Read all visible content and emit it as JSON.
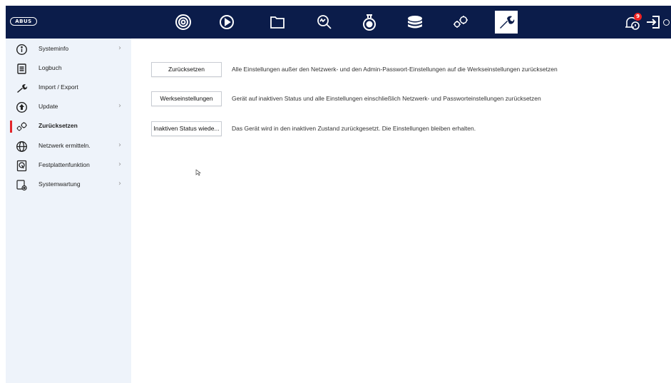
{
  "brand": {
    "logo_text": "ABUS"
  },
  "topbar": {
    "icons": [
      {
        "name": "live-view-icon",
        "label": "camera"
      },
      {
        "name": "playback-icon",
        "label": "play"
      },
      {
        "name": "file-management-icon",
        "label": "folder"
      },
      {
        "name": "smart-analysis-icon",
        "label": "search"
      },
      {
        "name": "camera-settings-icon",
        "label": "dome"
      },
      {
        "name": "storage-icon",
        "label": "storage"
      },
      {
        "name": "configuration-icon",
        "label": "gears"
      },
      {
        "name": "maintenance-icon",
        "label": "wrench",
        "active": true
      }
    ],
    "alarm_count": "9"
  },
  "sidebar": {
    "items": [
      {
        "label": "Systeminfo",
        "icon": "info-icon",
        "has_submenu": true
      },
      {
        "label": "Logbuch",
        "icon": "log-icon",
        "has_submenu": false
      },
      {
        "label": "Import / Export",
        "icon": "wrench-icon",
        "has_submenu": false
      },
      {
        "label": "Update",
        "icon": "update-icon",
        "has_submenu": true
      },
      {
        "label": "Zurücksetzen",
        "icon": "gears-icon",
        "has_submenu": false,
        "active": true
      },
      {
        "label": "Netzwerk ermitteln.",
        "icon": "globe-icon",
        "has_submenu": true
      },
      {
        "label": "Festplattenfunktion",
        "icon": "hdd-icon",
        "has_submenu": true
      },
      {
        "label": "Systemwartung",
        "icon": "maintenance-icon",
        "has_submenu": true
      }
    ],
    "chevron": "›"
  },
  "content": {
    "rows": [
      {
        "button": "Zurücksetzen",
        "description": "Alle Einstellungen außer den Netzwerk- und den Admin-Passwort-Einstellungen auf die Werkseinstellungen zurücksetzen"
      },
      {
        "button": "Werkseinstellungen",
        "description": "Gerät auf inaktiven Status und alle Einstellungen einschließlich Netzwerk- und Passworteinstellungen zurücksetzen"
      },
      {
        "button": "Inaktiven Status wiede...",
        "description": "Das Gerät wird in den inaktiven Zustand zurückgesetzt. Die Einstellungen bleiben erhalten."
      }
    ]
  },
  "colors": {
    "topbar": "#0b1c4a",
    "sidebar": "#eef3fa",
    "active_marker": "#e3262b",
    "badge": "#e22222"
  }
}
